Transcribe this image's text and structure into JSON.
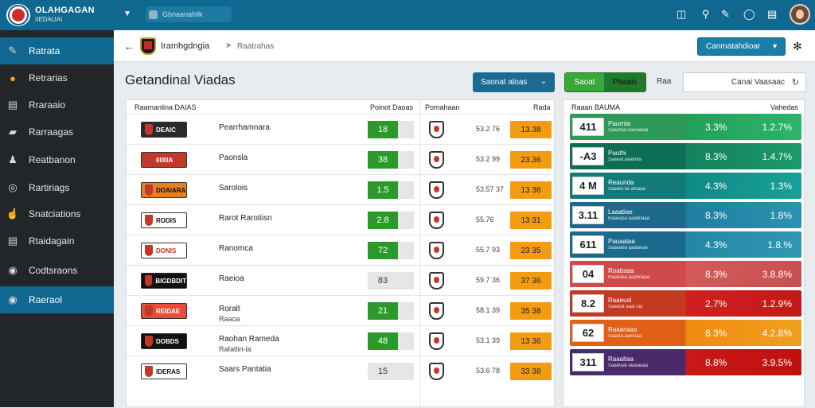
{
  "topbar": {
    "brand_title": "OLAHGAGAN",
    "brand_sub": "IIEDAUAI",
    "search_text": "Gbnaanahilk",
    "icons": [
      "camera-icon",
      "search-icon",
      "pen-icon",
      "chat-icon",
      "clipboard-icon"
    ]
  },
  "sidebar": {
    "items": [
      {
        "label": "Ratrata",
        "icon": "edit-icon"
      },
      {
        "label": "Retrarias",
        "icon": "coin-icon"
      },
      {
        "label": "Rraraaio",
        "icon": "card-icon"
      },
      {
        "label": "Rarraagas",
        "icon": "car-icon"
      },
      {
        "label": "Reatbanon",
        "icon": "user-icon"
      },
      {
        "label": "Rartiriags",
        "icon": "ball-icon"
      },
      {
        "label": "Snatciations",
        "icon": "thumb-icon"
      },
      {
        "label": "Rtaidagain",
        "icon": "card-icon"
      },
      {
        "label": "Codtsraons",
        "icon": "globe-icon"
      },
      {
        "label": "Raeraol",
        "icon": "globe-icon"
      }
    ]
  },
  "crumbs": {
    "current": "Iramhgdngia",
    "next": "Raatrahas"
  },
  "header": {
    "compare_label": "Canmatahdioar",
    "page_title": "Getandinal Viadas",
    "season_label": "Saonat aloas",
    "btn1": "Saoat",
    "btn2": "Paaais",
    "small_label": "Raa",
    "search_text": "Canai Vaasaac"
  },
  "left": {
    "col1": "Raamanlina DAIAS",
    "col2": "Poinot Daoas",
    "col3": "Pomahaan",
    "col4": "Rada",
    "rows": [
      {
        "logo": "DEAIC",
        "name": "Pearrhamnara",
        "sub": "",
        "score": "18",
        "odds": "53.2 76",
        "box": "13.38",
        "light": false
      },
      {
        "logo": "IIIIIIIA",
        "name": "Paonsla",
        "sub": "",
        "score": "38",
        "odds": "53.2 99",
        "box": "23.36",
        "light": false
      },
      {
        "logo": "DOAIARA",
        "name": "Sarolois",
        "sub": "",
        "score": "1.5",
        "odds": "53.57 37",
        "box": "13 36",
        "light": false
      },
      {
        "logo": "RODIS",
        "name": "Rarot Rarotiisn",
        "sub": "",
        "score": "2.8",
        "odds": "55.76",
        "box": "13 31",
        "light": false
      },
      {
        "logo": "DONIS",
        "name": "Ranomca",
        "sub": "",
        "score": "72",
        "odds": "55.7 93",
        "box": "23 35",
        "light": false
      },
      {
        "logo": "BIGDBDIT",
        "name": "Raeioa",
        "sub": "",
        "score": "83",
        "odds": "59.7 36",
        "box": "37 36",
        "light": true
      },
      {
        "logo": "REIDAE",
        "name": "Roralt",
        "sub": "Raaoa",
        "score": "21",
        "odds": "58.1 39",
        "box": "35 38",
        "light": false
      },
      {
        "logo": "DOBDS",
        "name": "Raohan Rameda",
        "sub": "Rafatlin-la",
        "score": "48",
        "odds": "53.1 39",
        "box": "13 36",
        "light": false
      },
      {
        "logo": "IDERAS",
        "name": "Saars Pantatia",
        "sub": "",
        "score": "15",
        "odds": "53.6 78",
        "box": "33 38",
        "light": true
      }
    ]
  },
  "right": {
    "col1": "Raaan BAUMA",
    "col2": "Vahedas",
    "rows": [
      {
        "box": "411",
        "label": "Paurnta",
        "sub": "Saaetaa-naoiaaiaa",
        "pct": "3.3%",
        "val": "1.2.7%",
        "c1": "#2e9a5a",
        "c2": "#22a05a",
        "c3": "#2bb56a"
      },
      {
        "box": "-A3",
        "label": "Pauthi",
        "sub": "Saaeat aaatirtia",
        "pct": "8.3%",
        "val": "1.4.7%",
        "c1": "#0e6e55",
        "c2": "#15805e",
        "c3": "#1a9a6a"
      },
      {
        "box": "4 M",
        "label": "Reaunda",
        "sub": "Saaeta tai ahiaaa",
        "pct": "4.3%",
        "val": "1.3%",
        "c1": "#137a7a",
        "c2": "#0f8a86",
        "c3": "#18a096"
      },
      {
        "box": "3.11",
        "label": "Laaatiae",
        "sub": "Raaeasa aaatinaaa",
        "pct": "8.3%",
        "val": "1.8%",
        "c1": "#1b6a8a",
        "c2": "#1f7fa0",
        "c3": "#2a93b0"
      },
      {
        "box": "611",
        "label": "Pauaalaa",
        "sub": "Saaeaea aaatiinae",
        "pct": "4.3%",
        "val": "1.8.%",
        "c1": "#1a6a8e",
        "c2": "#2387a4",
        "c3": "#3097b2"
      },
      {
        "box": "04",
        "label": "Roattaaa",
        "sub": "Raaeasa aaatinaaa",
        "pct": "8.3%",
        "val": "3.8.8%",
        "c1": "#d04a4a",
        "c2": "#d45a5a",
        "c3": "#c85050"
      },
      {
        "box": "8.2",
        "label": "Raaeusl",
        "sub": "Saaetat aaai nia",
        "pct": "2.7%",
        "val": "1.2.9%",
        "c1": "#c43a20",
        "c2": "#d02020",
        "c3": "#c41818"
      },
      {
        "box": "62",
        "label": "Raaanaas",
        "sub": "Saaeta aainnaa",
        "pct": "8.3%",
        "val": "4.2.8%",
        "c1": "#e06018",
        "c2": "#ef8a10",
        "c3": "#f0a020"
      },
      {
        "box": "311",
        "label": "Raaaltaa",
        "sub": "Saaetaal alaaaaaa",
        "pct": "8.8%",
        "val": "3.9.5%",
        "c1": "#4a2a6a",
        "c2": "#c81818",
        "c3": "#c01010"
      }
    ]
  }
}
